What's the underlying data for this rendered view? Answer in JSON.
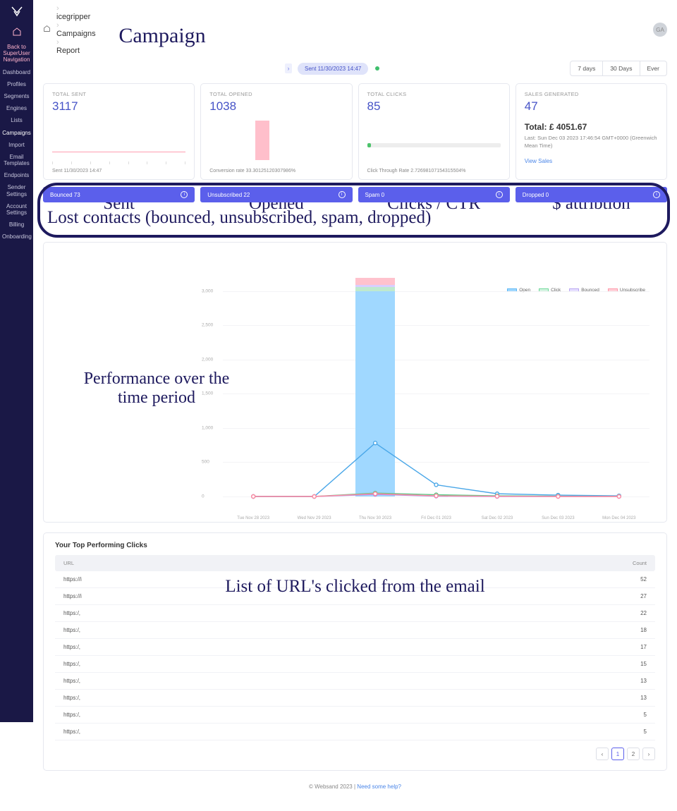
{
  "sidebar": {
    "back": "Back to SuperUser Navigation",
    "items": [
      {
        "label": "Dashboard"
      },
      {
        "label": "Profiles"
      },
      {
        "label": "Segments"
      },
      {
        "label": "Engines"
      },
      {
        "label": "Lists"
      },
      {
        "label": "Campaigns",
        "active": true
      },
      {
        "label": "Import"
      },
      {
        "label": "Email Templates"
      },
      {
        "label": "Endpoints"
      },
      {
        "label": "Sender Settings"
      },
      {
        "label": "Account Settings"
      },
      {
        "label": "Billing"
      },
      {
        "label": "Onboarding"
      }
    ]
  },
  "breadcrumbs": [
    "icegripper",
    "Campaigns",
    "Report"
  ],
  "avatar": "GA",
  "annotations": {
    "campaign": "Campaign",
    "sent": "Sent",
    "opened": "Opened",
    "clicks": "Clicks / CTR",
    "sales": "$ attribtion",
    "lost": "Lost contacts (bounced, unsubscribed, spam, dropped)",
    "perf": "Performance over the time period",
    "urls": "List of URL's clicked from the email"
  },
  "header": {
    "pill": "Sent 11/30/2023 14:47",
    "ranges": [
      "7 days",
      "30 Days",
      "Ever"
    ]
  },
  "cards": {
    "sent": {
      "label": "TOTAL SENT",
      "value": "3117",
      "foot": "Sent 11/30/2023 14:47"
    },
    "opened": {
      "label": "TOTAL OPENED",
      "value": "1038",
      "foot": "Conversion rate 33.30125120307986%"
    },
    "clicks": {
      "label": "TOTAL CLICKS",
      "value": "85",
      "foot": "Click Through Rate 2.72698107154315504%"
    },
    "sales": {
      "label": "SALES GENERATED",
      "value": "47",
      "total": "Total: £ 4051.67",
      "last": "Last: Sun Dec 03 2023 17:46:54 GMT+0000 (Greenwich Mean Time)",
      "link": "View Sales"
    }
  },
  "lost": [
    {
      "label": "Bounced 73"
    },
    {
      "label": "Unsubscribed 22"
    },
    {
      "label": "Spam 0"
    },
    {
      "label": "Dropped 0"
    }
  ],
  "chart_data": {
    "type": "bar",
    "title": "",
    "ylabel": "",
    "xlabel": "",
    "ylim": [
      0,
      3500
    ],
    "yticks": [
      0,
      500,
      1000,
      1500,
      2000,
      2500,
      3000
    ],
    "categories": [
      "Tue Nov 28 2023",
      "Wed Nov 29 2023",
      "Thu Nov 30 2023",
      "Fri Dec 01 2023",
      "Sat Dec 02 2023",
      "Sun Dec 03 2023",
      "Mon Dec 04 2023"
    ],
    "series": [
      {
        "name": "Open",
        "type": "bar",
        "color": "#a0d8ff",
        "values": [
          0,
          0,
          3000,
          0,
          0,
          0,
          0
        ]
      },
      {
        "name": "Click",
        "type": "bar",
        "color": "#bfe9ce",
        "values": [
          0,
          0,
          60,
          0,
          0,
          0,
          0
        ]
      },
      {
        "name": "Bounced",
        "type": "bar",
        "color": "#d9ceff",
        "values": [
          0,
          0,
          30,
          0,
          0,
          0,
          0
        ]
      },
      {
        "name": "Unsubscribe",
        "type": "bar",
        "color": "#ffc2cd",
        "values": [
          0,
          0,
          100,
          0,
          0,
          0,
          0
        ]
      },
      {
        "name": "Open-line",
        "type": "line",
        "color": "#4aa7e8",
        "values": [
          0,
          0,
          780,
          170,
          40,
          20,
          10
        ]
      },
      {
        "name": "Click-line",
        "type": "line",
        "color": "#58c988",
        "values": [
          0,
          0,
          50,
          25,
          10,
          5,
          3
        ]
      },
      {
        "name": "Bounce-line",
        "type": "line",
        "color": "#a98ee6",
        "values": [
          0,
          0,
          30,
          5,
          0,
          0,
          0
        ]
      },
      {
        "name": "Unsub-line",
        "type": "line",
        "color": "#ff8aa1",
        "values": [
          0,
          0,
          40,
          10,
          3,
          0,
          0
        ]
      }
    ],
    "legend": [
      "Open",
      "Click",
      "Bounced",
      "Unsubscribe"
    ]
  },
  "clicks_table": {
    "title": "Your Top Performing Clicks",
    "columns": [
      "URL",
      "Count"
    ],
    "rows": [
      {
        "url": "https://i",
        "count": "52"
      },
      {
        "url": "https://i",
        "count": "27"
      },
      {
        "url": "https:/,",
        "count": "22"
      },
      {
        "url": "https:/,",
        "count": "18"
      },
      {
        "url": "https:/,",
        "count": "17"
      },
      {
        "url": "https:/,",
        "count": "15"
      },
      {
        "url": "https:/,",
        "count": "13"
      },
      {
        "url": "https:/,",
        "count": "13"
      },
      {
        "url": "https:/,",
        "count": "5"
      },
      {
        "url": "https:/,",
        "count": "5"
      }
    ],
    "pages": [
      "1",
      "2"
    ]
  },
  "footer": {
    "copyright": "© Websand 2023",
    "sep": " | ",
    "help": "Need some help?"
  }
}
